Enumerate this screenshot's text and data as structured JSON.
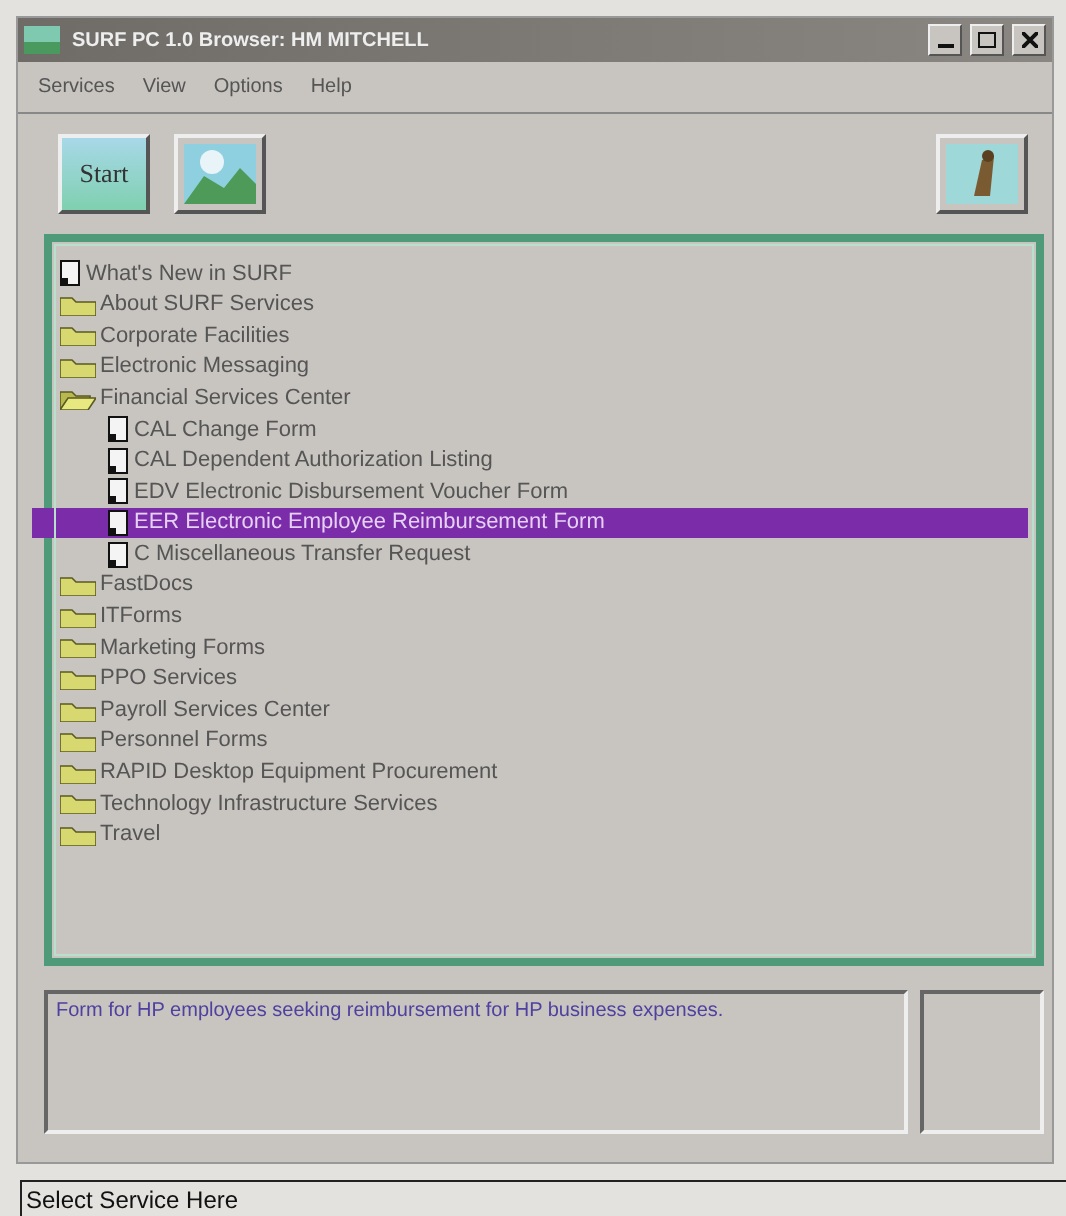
{
  "window": {
    "title": "SURF PC 1.0 Browser: HM MITCHELL"
  },
  "menu": [
    "Services",
    "View",
    "Options",
    "Help"
  ],
  "toolbar": {
    "start_label": "Start"
  },
  "tree": [
    {
      "label": "What's New in SURF",
      "kind": "document",
      "selected": false
    },
    {
      "label": "About SURF Services",
      "kind": "folder",
      "selected": false
    },
    {
      "label": "Corporate Facilities",
      "kind": "folder",
      "selected": false
    },
    {
      "label": "Electronic Messaging",
      "kind": "folder",
      "selected": false
    },
    {
      "label": "Financial Services Center",
      "kind": "folder",
      "selected": false,
      "expanded": true,
      "children": [
        {
          "label": "CAL Change Form",
          "kind": "document",
          "selected": false
        },
        {
          "label": "CAL Dependent Authorization Listing",
          "kind": "document",
          "selected": false
        },
        {
          "label": "EDV Electronic Disbursement Voucher Form",
          "kind": "document",
          "selected": false
        },
        {
          "label": "EER Electronic Employee Reimbursement Form",
          "kind": "document",
          "selected": true
        },
        {
          "label": "C Miscellaneous Transfer Request",
          "kind": "document",
          "selected": false
        }
      ]
    },
    {
      "label": "FastDocs",
      "kind": "folder",
      "selected": false
    },
    {
      "label": "ITForms",
      "kind": "folder",
      "selected": false
    },
    {
      "label": "Marketing Forms",
      "kind": "folder",
      "selected": false
    },
    {
      "label": "PPO Services",
      "kind": "folder",
      "selected": false
    },
    {
      "label": "Payroll Services Center",
      "kind": "folder",
      "selected": false
    },
    {
      "label": "Personnel Forms",
      "kind": "folder",
      "selected": false
    },
    {
      "label": "RAPID Desktop Equipment Procurement",
      "kind": "folder",
      "selected": false
    },
    {
      "label": "Technology Infrastructure Services",
      "kind": "folder",
      "selected": false
    },
    {
      "label": "Travel",
      "kind": "folder",
      "selected": false
    }
  ],
  "description": "Form for HP employees seeking reimbursement for HP business expenses.",
  "status_bar": "Select Service Here"
}
